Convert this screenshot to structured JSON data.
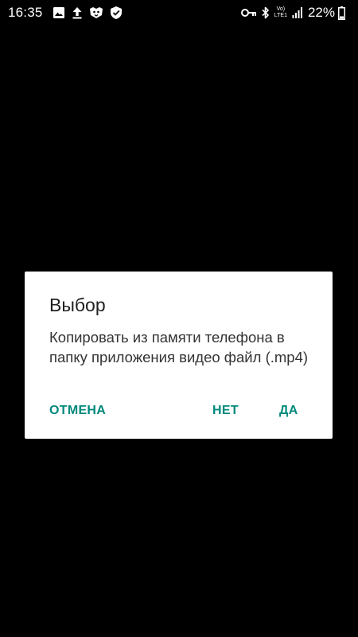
{
  "status_bar": {
    "time": "16:35",
    "volte_top": "Vo)",
    "volte_bottom": "LTE1",
    "battery_percent": "22%",
    "icons_left": [
      "image-icon",
      "upload-icon",
      "lion-app-icon",
      "shield-check-icon"
    ],
    "icons_right": [
      "key-icon",
      "bluetooth-icon",
      "volte-lte-icon",
      "signal-icon",
      "battery-icon"
    ]
  },
  "dialog": {
    "title": "Выбор",
    "message": "Копировать из памяти телефона в папку приложения видео файл (.mp4)",
    "buttons": {
      "cancel": "ОТМЕНА",
      "no": "НЕТ",
      "yes": "ДА"
    }
  },
  "colors": {
    "background": "#000000",
    "dialog_background": "#ffffff",
    "accent": "#00897b",
    "title_text": "#212121",
    "message_text": "#333333"
  }
}
